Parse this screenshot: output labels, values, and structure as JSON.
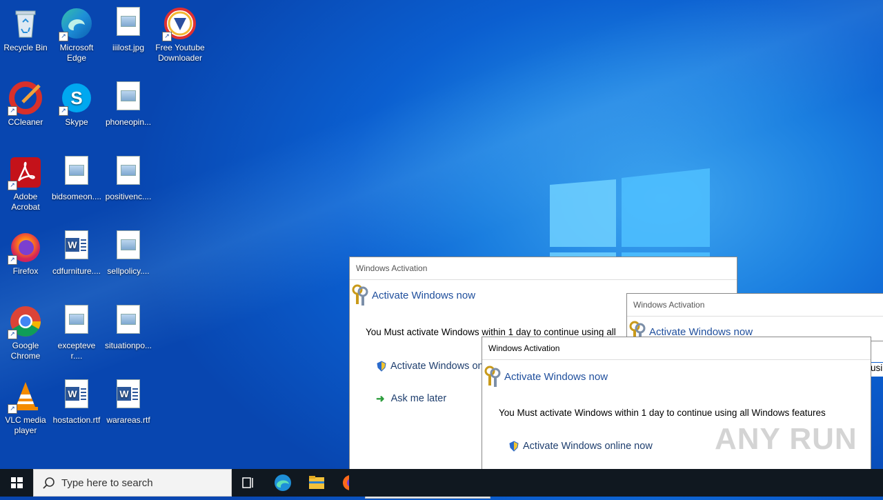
{
  "desktop": {
    "icons": [
      {
        "label": "Recycle Bin",
        "icon": "recycle-bin-icon"
      },
      {
        "label": "Microsoft Edge",
        "icon": "edge-icon"
      },
      {
        "label": "iiilost.jpg",
        "icon": "image-file-icon"
      },
      {
        "label": "Free Youtube Downloader",
        "icon": "youtube-downloader-icon"
      },
      {
        "label": "CCleaner",
        "icon": "ccleaner-icon"
      },
      {
        "label": "Skype",
        "icon": "skype-icon"
      },
      {
        "label": "phoneopin...",
        "icon": "image-file-icon"
      },
      {
        "label": "Adobe Acrobat",
        "icon": "acrobat-icon"
      },
      {
        "label": "bidsomeon....",
        "icon": "image-file-icon"
      },
      {
        "label": "positivenc....",
        "icon": "image-file-icon"
      },
      {
        "label": "Firefox",
        "icon": "firefox-icon"
      },
      {
        "label": "cdfurniture....",
        "icon": "word-file-icon"
      },
      {
        "label": "sellpolicy....",
        "icon": "image-file-icon"
      },
      {
        "label": "Google Chrome",
        "icon": "chrome-icon"
      },
      {
        "label": "excepteve r....",
        "icon": "image-file-icon"
      },
      {
        "label": "situationpo...",
        "icon": "image-file-icon"
      },
      {
        "label": "VLC media player",
        "icon": "vlc-icon"
      },
      {
        "label": "hostaction.rtf",
        "icon": "word-file-icon"
      },
      {
        "label": "warareas.rtf",
        "icon": "word-file-icon"
      }
    ]
  },
  "taskbar": {
    "search_placeholder": "Type here to search"
  },
  "dialogs": {
    "title": "Windows Activation",
    "header_link": "Activate Windows now",
    "message": "You Must activate Windows within 1 day to continue using all Windows features",
    "option_activate": "Activate Windows online now",
    "option_later": "Ask me later",
    "back_msg_partial": "You Must activate Windows within 1 day to continue using all",
    "back_opt_partial": "Activate Windows on",
    "right_overflow_text": "usi"
  },
  "watermark": "ANY RUN",
  "colors": {
    "desktop_blue": "#0b5fd0",
    "link_blue": "#1e4e9c",
    "taskbar": "#101820"
  }
}
